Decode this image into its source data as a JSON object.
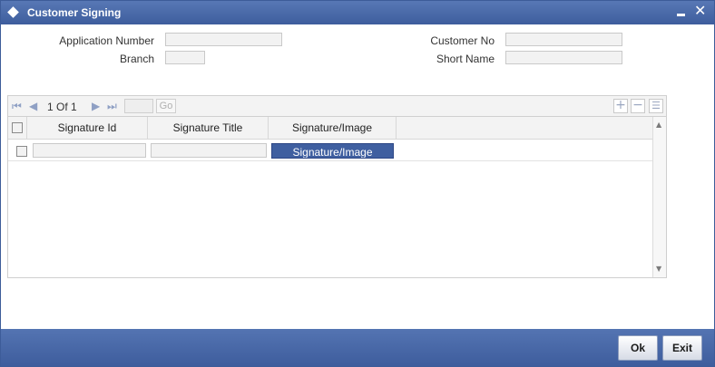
{
  "window": {
    "title": "Customer Signing",
    "minimize_glyph": "▄",
    "close_glyph": "✕"
  },
  "form": {
    "application_number_label": "Application Number",
    "branch_label": "Branch",
    "customer_no_label": "Customer No",
    "short_name_label": "Short Name",
    "application_number_value": "",
    "branch_value": "",
    "customer_no_value": "",
    "short_name_value": ""
  },
  "grid": {
    "pagination": {
      "text": "1 Of 1",
      "page_input": "",
      "go_label": "Go"
    },
    "toolbar_icons": [
      "add-row-icon",
      "delete-row-icon",
      "single-view-icon"
    ],
    "columns": [
      "Signature Id",
      "Signature Title",
      "Signature/Image"
    ],
    "rows": [
      {
        "signature_id": "",
        "signature_title": "",
        "image_button_label": "Signature/Image"
      }
    ]
  },
  "footer": {
    "ok_label": "Ok",
    "exit_label": "Exit"
  },
  "colors": {
    "title_bar": "#3e5d9d",
    "footer": "#3e5d9d",
    "signature_button": "#3f5fa0"
  }
}
